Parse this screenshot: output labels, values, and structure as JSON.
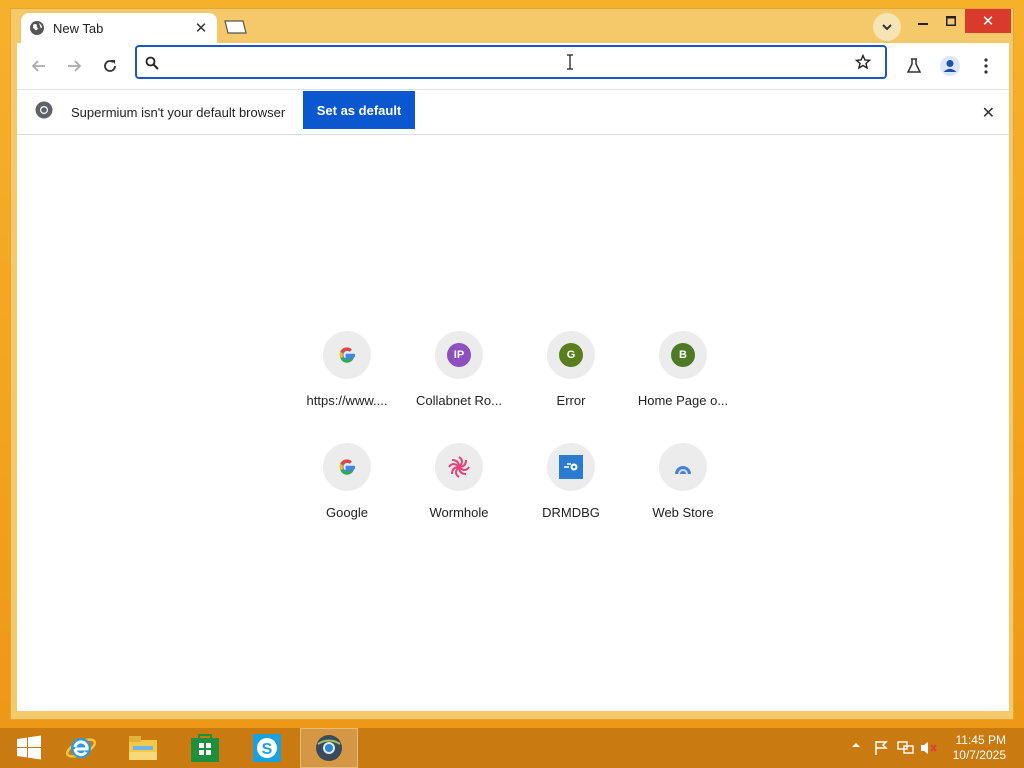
{
  "window": {
    "tab_title": "New Tab",
    "tab_close": "✕",
    "close_glyph": "✕"
  },
  "toolbar": {
    "omnibox_value": "",
    "omnibox_placeholder": ""
  },
  "infobar": {
    "message": "Supermium isn't your default browser",
    "set_default_label": "Set as default",
    "close_glyph": "✕"
  },
  "shortcuts": [
    {
      "label": "https://www....",
      "icon": "google-g-icon"
    },
    {
      "label": "Collabnet Ro...",
      "icon": "letter-icon",
      "letter": "IP",
      "color": "#8e4fbf"
    },
    {
      "label": "Error",
      "icon": "letter-icon",
      "letter": "G",
      "color": "#5a7d1e"
    },
    {
      "label": "Home Page o...",
      "icon": "letter-icon",
      "letter": "B",
      "color": "#4e7a25"
    },
    {
      "label": "Google",
      "icon": "google-g-icon"
    },
    {
      "label": "Wormhole",
      "icon": "wormhole-icon",
      "color": "#e8407a"
    },
    {
      "label": "DRMDBG",
      "icon": "drmdbg-icon",
      "color": "#2b7bd3"
    },
    {
      "label": "Web Store",
      "icon": "web-store-icon",
      "color": "#4a7fd6"
    }
  ],
  "taskbar": {
    "time": "11:45 PM",
    "date": "10/7/2025",
    "apps": [
      "start-icon",
      "internet-explorer-icon",
      "file-explorer-icon",
      "store-icon",
      "skype-icon",
      "supermium-icon"
    ]
  },
  "colors": {
    "accent": "#0b57d0",
    "window_frame": "#f5c86a",
    "taskbar": "#c97a10"
  }
}
